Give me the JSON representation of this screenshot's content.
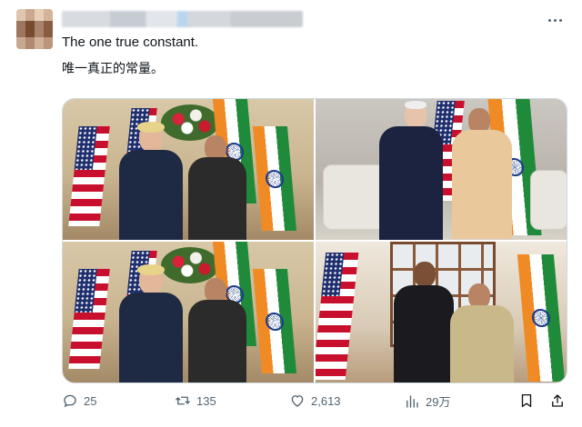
{
  "tweet": {
    "text_line1": "The one true constant.",
    "text_line2": "唯一真正的常量。"
  },
  "actions": {
    "replies": "25",
    "retweets": "135",
    "likes": "2,613",
    "views": "29万"
  },
  "icons": {
    "more": "more-horizontal-icon",
    "reply": "reply-icon",
    "retweet": "retweet-icon",
    "like": "heart-icon",
    "views": "bar-chart-icon",
    "bookmark": "bookmark-icon",
    "share": "share-icon"
  },
  "colors": {
    "icon_gray": "#536471",
    "text": "#0f1419",
    "border": "#cfd9de"
  }
}
